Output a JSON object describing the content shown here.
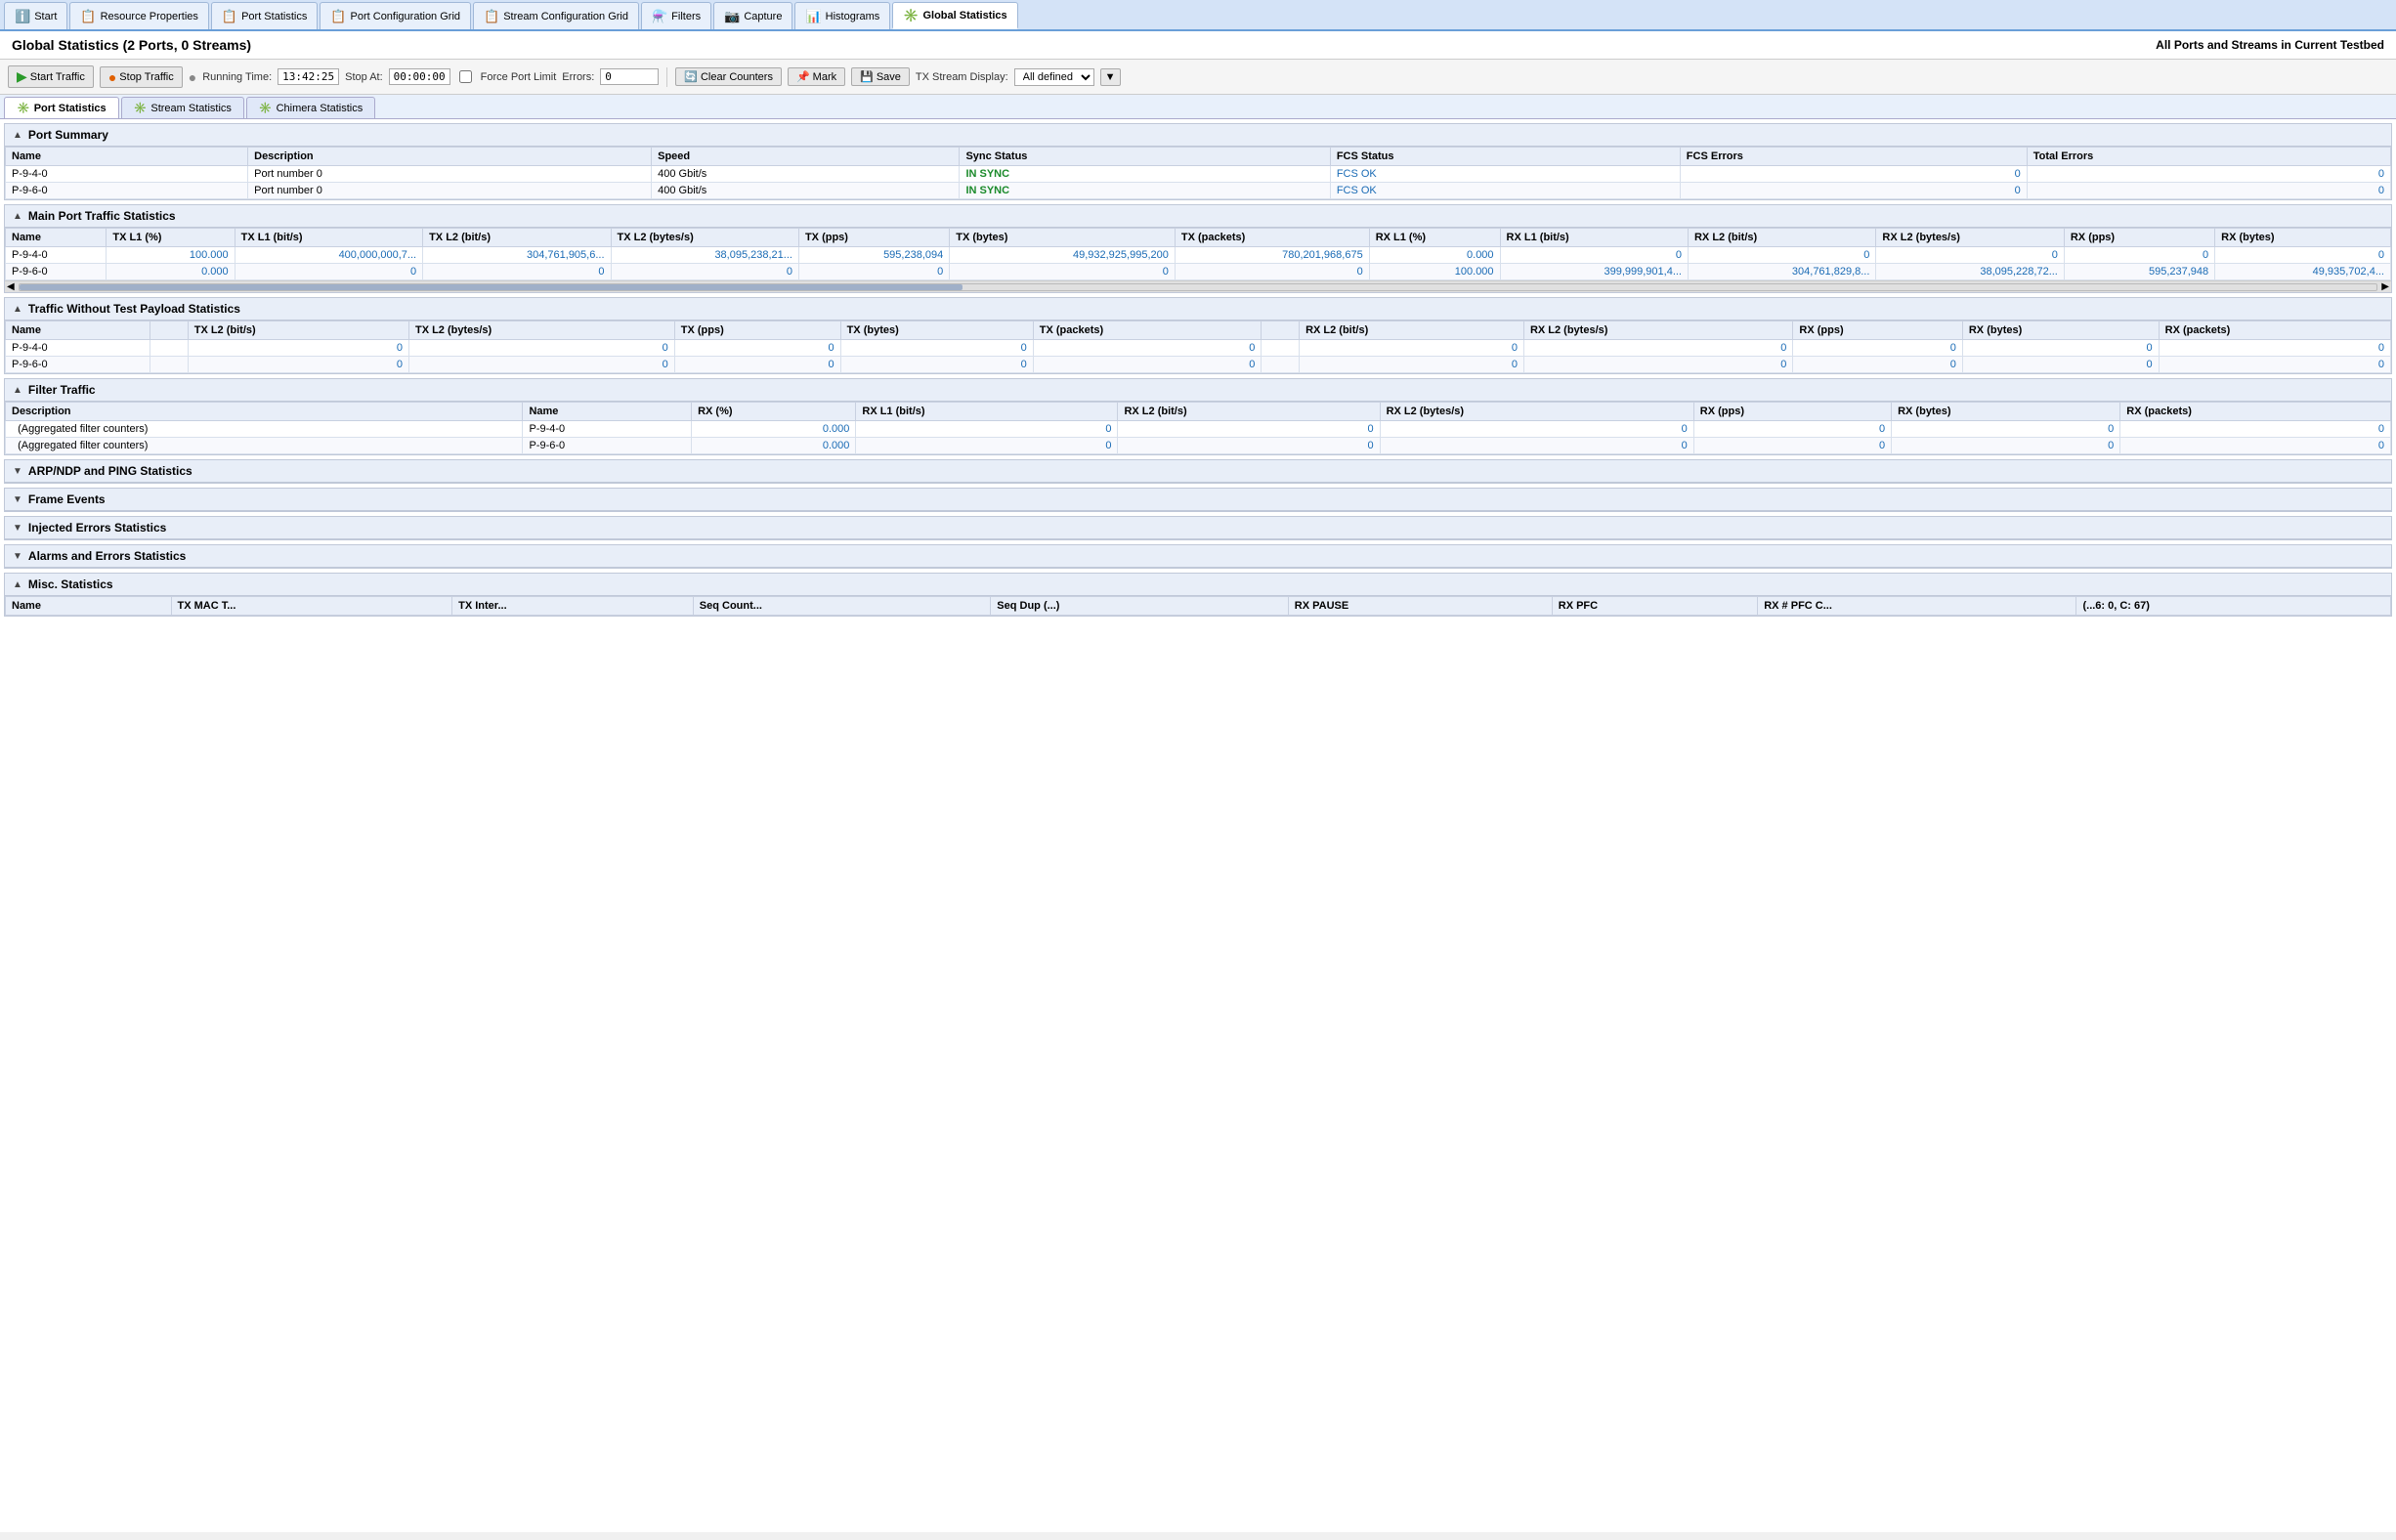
{
  "top_tabs": [
    {
      "id": "start",
      "label": "Start",
      "icon": "ℹ️",
      "active": false
    },
    {
      "id": "resource",
      "label": "Resource Properties",
      "icon": "📋",
      "active": false
    },
    {
      "id": "port_stats",
      "label": "Port Statistics",
      "icon": "📋",
      "active": false
    },
    {
      "id": "port_config",
      "label": "Port Configuration Grid",
      "icon": "📋",
      "active": false
    },
    {
      "id": "stream_config",
      "label": "Stream Configuration Grid",
      "icon": "📋",
      "active": false
    },
    {
      "id": "filters",
      "label": "Filters",
      "icon": "⚗️",
      "active": false
    },
    {
      "id": "capture",
      "label": "Capture",
      "icon": "📷",
      "active": false
    },
    {
      "id": "histograms",
      "label": "Histograms",
      "icon": "📊",
      "active": false
    },
    {
      "id": "global_stats",
      "label": "Global Statistics",
      "icon": "✳️",
      "active": true
    }
  ],
  "header": {
    "title": "Global Statistics (2 Ports, 0 Streams)",
    "subtitle": "All Ports and Streams in Current Testbed"
  },
  "toolbar": {
    "start_traffic": "Start Traffic",
    "stop_traffic": "Stop Traffic",
    "running_time_label": "Running Time:",
    "running_time_value": "13:42:25",
    "stop_at_label": "Stop At:",
    "stop_at_value": "00:00:00",
    "force_port_limit": "Force Port Limit",
    "errors_label": "Errors:",
    "errors_value": "0",
    "clear_counters": "Clear Counters",
    "mark": "Mark",
    "save": "Save",
    "tx_stream_display_label": "TX Stream Display:",
    "tx_stream_display_value": "All defined"
  },
  "sub_tabs": [
    {
      "id": "port_statistics",
      "label": "Port Statistics",
      "icon": "✳️",
      "active": true
    },
    {
      "id": "stream_statistics",
      "label": "Stream Statistics",
      "icon": "✳️",
      "active": false
    },
    {
      "id": "chimera_statistics",
      "label": "Chimera Statistics",
      "icon": "✳️",
      "active": false
    }
  ],
  "sections": {
    "port_summary": {
      "title": "Port Summary",
      "collapsed": false,
      "columns": [
        "Name",
        "Description",
        "Speed",
        "Sync Status",
        "FCS Status",
        "FCS Errors",
        "Total Errors"
      ],
      "rows": [
        {
          "name": "P-9-4-0",
          "description": "Port number 0",
          "speed": "400 Gbit/s",
          "sync_status": "IN SYNC",
          "fcs_status": "FCS OK",
          "fcs_errors": "0",
          "total_errors": "0"
        },
        {
          "name": "P-9-6-0",
          "description": "Port number 0",
          "speed": "400 Gbit/s",
          "sync_status": "IN SYNC",
          "fcs_status": "FCS OK",
          "fcs_errors": "0",
          "total_errors": "0"
        }
      ]
    },
    "main_port_traffic": {
      "title": "Main Port Traffic Statistics",
      "collapsed": false,
      "columns": [
        "Name",
        "TX L1 (%)",
        "TX L1 (bit/s)",
        "TX L2 (bit/s)",
        "TX L2 (bytes/s)",
        "TX (pps)",
        "TX (bytes)",
        "TX (packets)",
        "RX L1 (%)",
        "RX L1 (bit/s)",
        "RX L2 (bit/s)",
        "RX L2 (bytes/s)",
        "RX (pps)",
        "RX (bytes)"
      ],
      "rows": [
        {
          "name": "P-9-4-0",
          "tx_l1_pct": "100.000",
          "tx_l1_bits": "400,000,000,7...",
          "tx_l2_bits": "304,761,905,6...",
          "tx_l2_bytes": "38,095,238,21...",
          "tx_pps": "595,238,094",
          "tx_bytes": "49,932,925,995,200",
          "tx_packets": "780,201,968,675",
          "rx_l1_pct": "0.000",
          "rx_l1_bits": "0",
          "rx_l2_bits": "0",
          "rx_l2_bytes": "0",
          "rx_pps": "0",
          "rx_bytes": "0"
        },
        {
          "name": "P-9-6-0",
          "tx_l1_pct": "0.000",
          "tx_l1_bits": "0",
          "tx_l2_bits": "0",
          "tx_l2_bytes": "0",
          "tx_pps": "0",
          "tx_bytes": "0",
          "tx_packets": "0",
          "rx_l1_pct": "100.000",
          "rx_l1_bits": "399,999,901,4...",
          "rx_l2_bits": "304,761,829,8...",
          "rx_l2_bytes": "38,095,228,72...",
          "rx_pps": "595,237,948",
          "rx_bytes": "49,935,702,4..."
        }
      ]
    },
    "traffic_no_payload": {
      "title": "Traffic Without Test Payload Statistics",
      "collapsed": false,
      "columns": [
        "Name",
        "",
        "TX L2 (bit/s)",
        "TX L2 (bytes/s)",
        "TX (pps)",
        "TX (bytes)",
        "TX (packets)",
        "",
        "RX L2 (bit/s)",
        "RX L2 (bytes/s)",
        "RX (pps)",
        "RX (bytes)",
        "RX (packets)"
      ],
      "rows": [
        {
          "name": "P-9-4-0",
          "tx_l2_bits": "0",
          "tx_l2_bytes": "0",
          "tx_pps": "0",
          "tx_bytes": "0",
          "tx_packets": "0",
          "rx_l2_bits": "0",
          "rx_l2_bytes": "0",
          "rx_pps": "0",
          "rx_bytes": "0",
          "rx_packets": "0"
        },
        {
          "name": "P-9-6-0",
          "tx_l2_bits": "0",
          "tx_l2_bytes": "0",
          "tx_pps": "0",
          "tx_bytes": "0",
          "tx_packets": "0",
          "rx_l2_bits": "0",
          "rx_l2_bytes": "0",
          "rx_pps": "0",
          "rx_bytes": "0",
          "rx_packets": "0"
        }
      ]
    },
    "filter_traffic": {
      "title": "Filter Traffic",
      "collapsed": false,
      "columns": [
        "Description",
        "Name",
        "RX (%)",
        "RX L1 (bit/s)",
        "RX L2 (bit/s)",
        "RX L2 (bytes/s)",
        "RX (pps)",
        "RX (bytes)",
        "RX (packets)"
      ],
      "rows": [
        {
          "description": "(Aggregated filter counters)",
          "name": "P-9-4-0",
          "rx_pct": "0.000",
          "rx_l1_bits": "0",
          "rx_l2_bits": "0",
          "rx_l2_bytes": "0",
          "rx_pps": "0",
          "rx_bytes": "0",
          "rx_packets": "0"
        },
        {
          "description": "(Aggregated filter counters)",
          "name": "P-9-6-0",
          "rx_pct": "0.000",
          "rx_l1_bits": "0",
          "rx_l2_bits": "0",
          "rx_l2_bytes": "0",
          "rx_pps": "0",
          "rx_bytes": "0",
          "rx_packets": "0"
        }
      ]
    },
    "arp_ndp": {
      "title": "ARP/NDP and PING Statistics",
      "collapsed": true
    },
    "frame_events": {
      "title": "Frame Events",
      "collapsed": true
    },
    "injected_errors": {
      "title": "Injected Errors Statistics",
      "collapsed": true
    },
    "alarms_errors": {
      "title": "Alarms and Errors Statistics",
      "collapsed": true
    },
    "misc": {
      "title": "Misc. Statistics",
      "collapsed": false,
      "columns": [
        "Name",
        "TX MAC T...",
        "TX Inter...",
        "Seq Count...",
        "Seq Dup (...)",
        "RX PAUSE",
        "RX PFC",
        "RX # PFC C...",
        "(...6: 0, C: 67)"
      ],
      "rows": []
    }
  }
}
